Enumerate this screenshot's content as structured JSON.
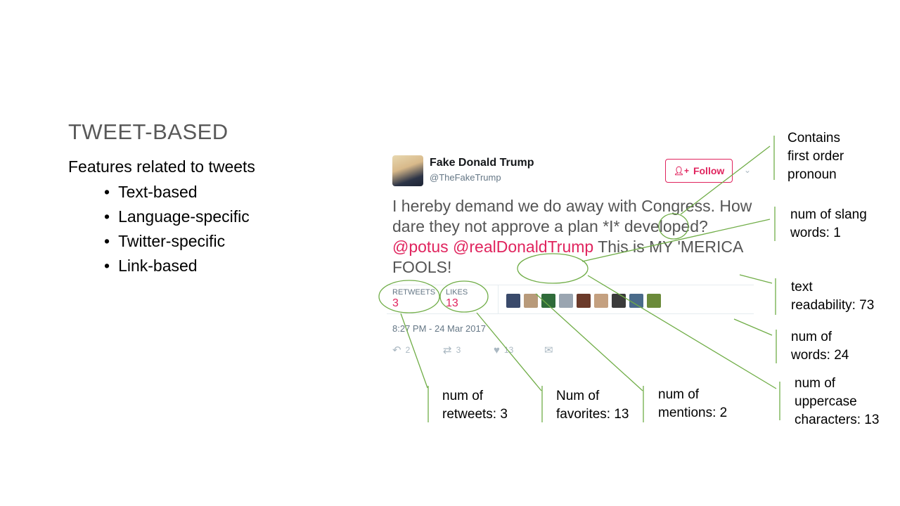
{
  "slide": {
    "title": "TWEET-BASED",
    "subtitle": "Features related to tweets",
    "bullets": [
      "Text-based",
      "Language-specific",
      "Twitter-specific",
      "Link-based"
    ]
  },
  "tweet": {
    "user_name": "Fake Donald Trump",
    "handle": "@TheFakeTrump",
    "follow_label": "Follow",
    "text_before": "I hereby demand we do away with Congress. How dare they not approve a plan *I* developed? ",
    "mention_1": "@potus",
    "mention_2": "@realDonaldTrump",
    "text_after": " This is MY 'MERICA FOOLS!",
    "retweets_label": "RETWEETS",
    "retweets_value": "3",
    "likes_label": "LIKES",
    "likes_value": "13",
    "timestamp": "8:27 PM - 24 Mar 2017",
    "reply_count": "2",
    "retweet_count": "3",
    "like_count": "13",
    "liker_colors": [
      "#3a4a6b",
      "#b89a7a",
      "#2f6b3a",
      "#9aa5b1",
      "#6b3a2a",
      "#c4a080",
      "#3b3b3b",
      "#4a6b8a",
      "#6b8a3a"
    ]
  },
  "annotations": {
    "pronoun": [
      "Contains",
      "first order",
      "pronoun"
    ],
    "slang": [
      "num of slang",
      "words: 1"
    ],
    "readability": [
      "text",
      "readability: 73"
    ],
    "words": [
      "num of",
      "words: 24"
    ],
    "uppercase": [
      "num of",
      "uppercase",
      "characters: 13"
    ],
    "retweets": [
      "num of",
      "retweets: 3"
    ],
    "favorites": [
      "Num of",
      "favorites: 13"
    ],
    "mentions": [
      "num of",
      "mentions: 2"
    ]
  },
  "colors": {
    "line": "#70ad47",
    "mention": "#e0245e",
    "title": "#595959"
  }
}
